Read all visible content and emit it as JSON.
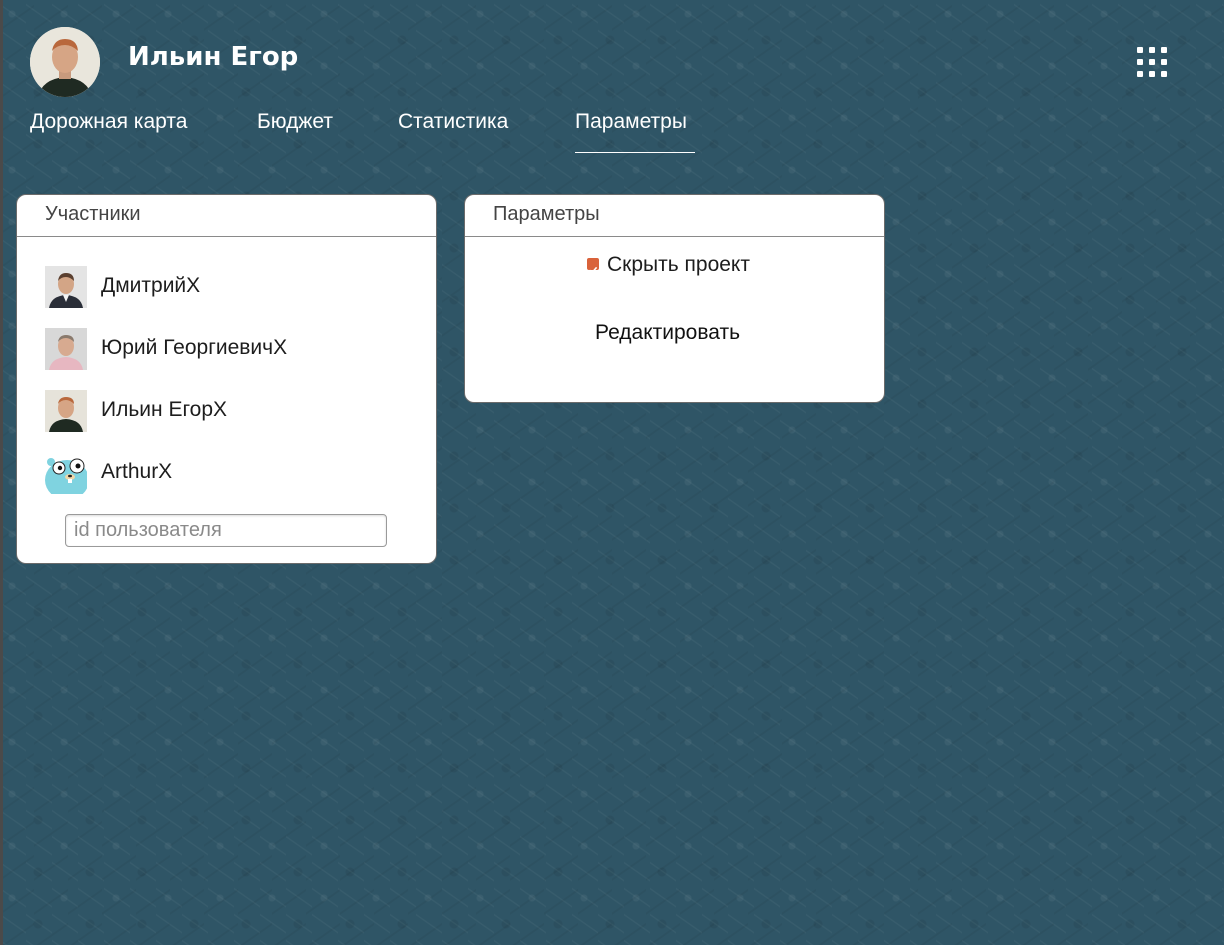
{
  "user": {
    "name": "Ильин Егор"
  },
  "nav": {
    "tabs": [
      {
        "label": "Дорожная карта"
      },
      {
        "label": "Бюджет"
      },
      {
        "label": "Статистика"
      },
      {
        "label": "Параметры",
        "active": true
      }
    ]
  },
  "participants": {
    "title": "Участники",
    "members": [
      {
        "name": "ДмитрийX",
        "avatar": "person-suit-avatar"
      },
      {
        "name": "Юрий ГеоргиевичX",
        "avatar": "person-pink-avatar"
      },
      {
        "name": "Ильин ЕгорX",
        "avatar": "person-dark-avatar"
      },
      {
        "name": "ArthurX",
        "avatar": "gopher-avatar"
      }
    ],
    "input": {
      "value": "",
      "placeholder": "id пользователя"
    }
  },
  "settings": {
    "title": "Параметры",
    "hide_project": {
      "label": "Скрыть проект",
      "checked": true
    },
    "edit_label": "Редактировать"
  },
  "colors": {
    "background": "#2f5566",
    "accent": "#d9623a",
    "card": "#ffffff"
  }
}
